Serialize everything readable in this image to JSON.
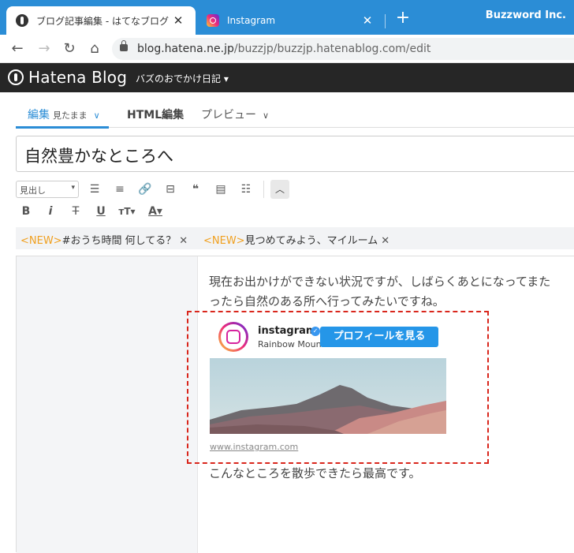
{
  "browser": {
    "tabs": [
      {
        "title": "ブログ記事編集 - はてなブログ"
      },
      {
        "title": "Instagram"
      }
    ],
    "profile_name": "Buzzword Inc.",
    "url_host": "blog.hatena.ne.jp",
    "url_path": "/buzzjp/buzzjp.hatenablog.com/edit"
  },
  "hatena": {
    "logo_text": "Hatena Blog",
    "blog_name": "バズのおでかけ日記"
  },
  "editor": {
    "tabs": {
      "edit": "編集",
      "edit_mode": "見たまま",
      "html": "HTML編集",
      "preview": "プレビュー"
    },
    "title": "自然豊かなところへ",
    "format_select": "見出し",
    "news": [
      {
        "badge": "<NEW>",
        "text": "#おうち時間 何してる？"
      },
      {
        "badge": "<NEW>",
        "text": "見つめてみよう、マイルーム"
      }
    ],
    "paragraph1_line1": "現在お出かけができない状況ですが、しばらくあとになってまた",
    "paragraph1_line2": "ったら自然のある所へ行ってみたいですね。",
    "paragraph2": "こんなところを散歩できたら最高です。"
  },
  "instagram_embed": {
    "account": "instagram",
    "subtitle": "Rainbow Mountain",
    "profile_button": "プロフィールを見る",
    "link": "www.instagram.com"
  },
  "colors": {
    "accent": "#2b8dd6",
    "header_bg": "#262626",
    "highlight_border": "#d9261c",
    "new_badge": "#f0a020"
  }
}
